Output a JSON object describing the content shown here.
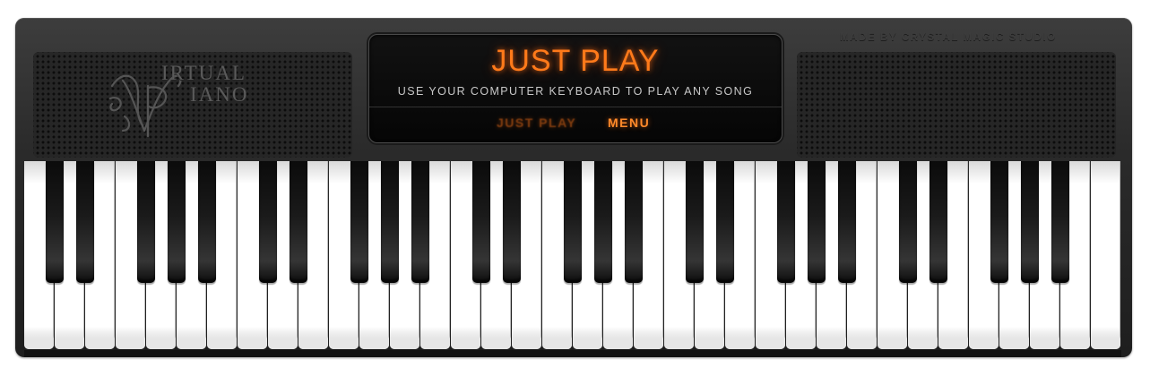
{
  "branding": {
    "logo_word_1": "IRTUAL",
    "logo_word_2": "IANO",
    "credit": "MADE BY CRYSTAL MAGIC STUDIO"
  },
  "display": {
    "title": "JUST PLAY",
    "subtitle": "USE YOUR COMPUTER KEYBOARD TO PLAY ANY SONG",
    "nav": [
      {
        "label": "JUST PLAY",
        "active": false
      },
      {
        "label": "MENU",
        "active": true
      }
    ]
  },
  "keyboard": {
    "white_key_count": 36,
    "octave_pattern_black_after_white": [
      0,
      1,
      3,
      4,
      5
    ],
    "colors": {
      "accent": "#ff7a1a",
      "body": "#2a2a2a",
      "white_key": "#ffffff",
      "black_key": "#111111"
    }
  }
}
